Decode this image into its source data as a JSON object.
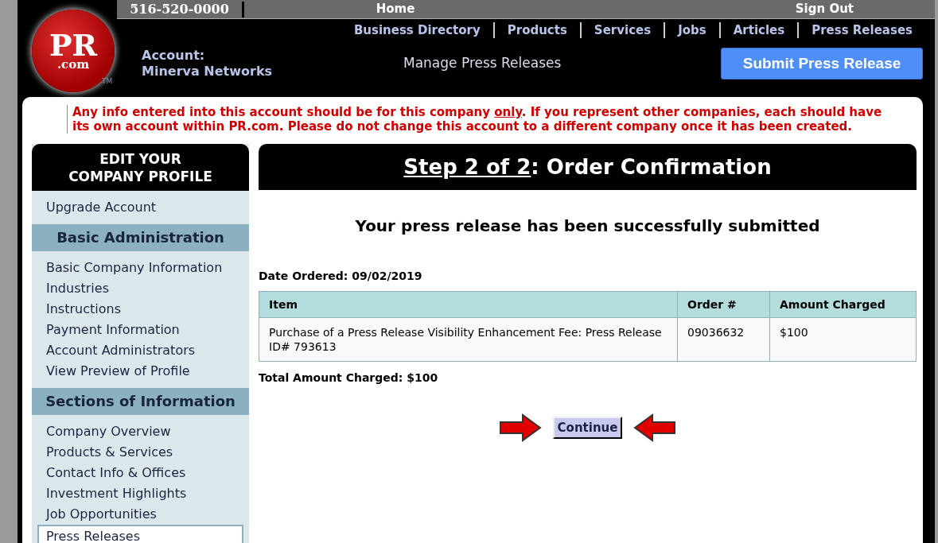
{
  "top_bar": {
    "phone": "516-520-0000",
    "links": [
      "Home",
      "Sign Out"
    ]
  },
  "nav": [
    "Business Directory",
    "Products",
    "Services",
    "Jobs",
    "Articles",
    "Press Releases"
  ],
  "logo": {
    "text": "PR",
    "subtext": ".com",
    "mark": "TM"
  },
  "account": {
    "label": "Account:",
    "name": "Minerva Networks"
  },
  "manage_link": "Manage Press Releases",
  "submit_button": "Submit Press Release",
  "notice": {
    "before": "Any info entered into this account should be for this company ",
    "underlined": "only",
    "after": ". If you represent other companies, each should have its own account within PR.com. Please do not change this account to a different company once it has been created."
  },
  "sidebar": {
    "title": "EDIT YOUR COMPANY PROFILE",
    "items": [
      {
        "kind": "link",
        "label": "Upgrade Account",
        "selected": false
      },
      {
        "kind": "heading",
        "label": "Basic Administration"
      },
      {
        "kind": "link",
        "label": "Basic Company Information",
        "selected": false
      },
      {
        "kind": "link",
        "label": "Industries",
        "selected": false
      },
      {
        "kind": "link",
        "label": "Instructions",
        "selected": false
      },
      {
        "kind": "link",
        "label": "Payment Information",
        "selected": false
      },
      {
        "kind": "link",
        "label": "Account Administrators",
        "selected": false
      },
      {
        "kind": "link",
        "label": "View Preview of Profile",
        "selected": false
      },
      {
        "kind": "heading",
        "label": "Sections of Information"
      },
      {
        "kind": "link",
        "label": "Company Overview",
        "selected": false
      },
      {
        "kind": "link",
        "label": "Products & Services",
        "selected": false
      },
      {
        "kind": "link",
        "label": "Contact Info & Offices",
        "selected": false
      },
      {
        "kind": "link",
        "label": "Investment Highlights",
        "selected": false
      },
      {
        "kind": "link",
        "label": "Job Opportunities",
        "selected": false
      },
      {
        "kind": "link",
        "label": "Press Releases",
        "selected": true
      }
    ]
  },
  "main": {
    "heading": {
      "step": "Step 2 of 2",
      "title": ": Order Confirmation"
    },
    "message": "Your press release has been successfully submitted",
    "date_ordered": "Date Ordered: 09/02/2019",
    "table": {
      "columns": [
        "Item",
        "Order #",
        "Amount Charged"
      ],
      "rows": [
        [
          "Purchase of a Press Release Visibility Enhancement Fee: Press Release ID# 793613",
          "09036632",
          "$100"
        ]
      ]
    },
    "total": "Total Amount Charged: $100",
    "continue_button": "Continue"
  }
}
